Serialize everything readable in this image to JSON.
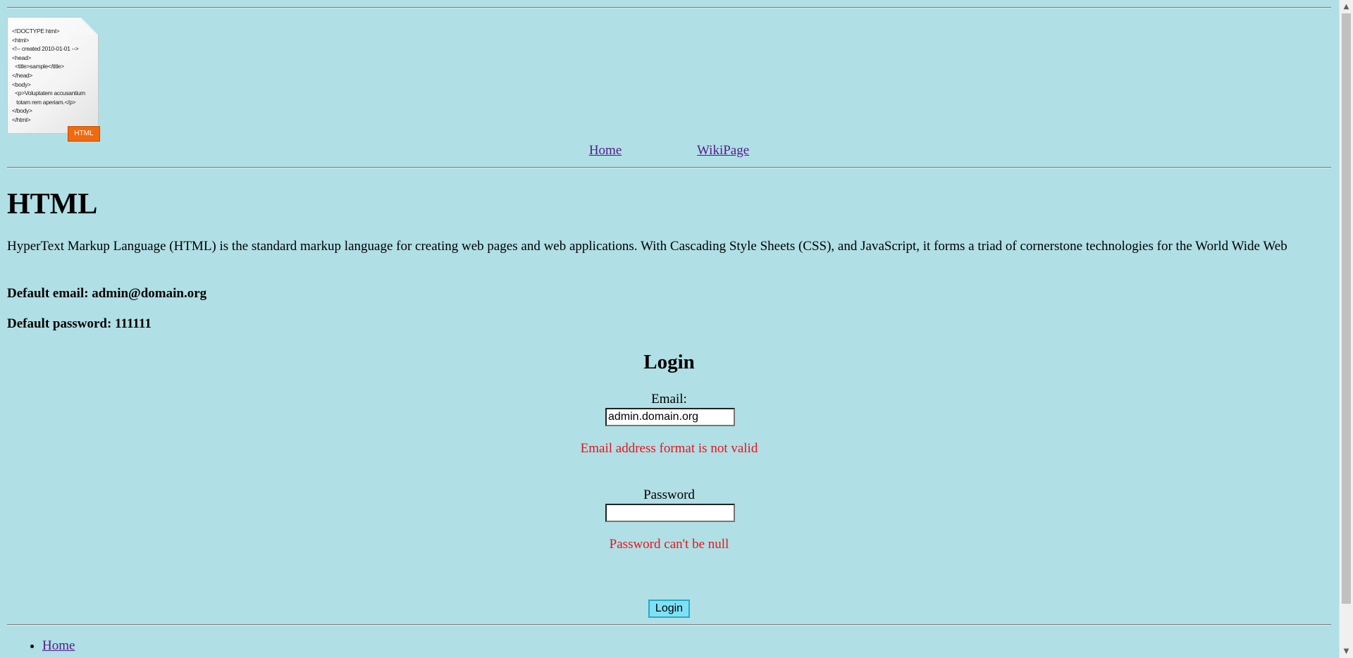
{
  "logo": {
    "code_lines": [
      "<!DOCTYPE html>",
      "<html>",
      "<!-- created 2010-01-01 -->",
      "<head>",
      "  <title>sample</title>",
      "</head>",
      "<body>",
      "  <p>Voluptatem accusantium",
      "   totam rem aperiam.</p>",
      "</body>",
      "</html>"
    ],
    "badge": "HTML"
  },
  "nav": {
    "home": "Home",
    "wiki": "WikiPage"
  },
  "main": {
    "title": "HTML",
    "intro": "HyperText Markup Language (HTML) is the standard markup language for creating web pages and web applications. With Cascading Style Sheets (CSS), and JavaScript, it forms a triad of cornerstone technologies for the World Wide Web",
    "default_email": "Default email: admin@domain.org",
    "default_password": "Default password: 111111"
  },
  "login": {
    "title": "Login",
    "email_label": "Email:",
    "email_value": "admin.domain.org",
    "email_error": "Email address format is not valid",
    "password_label": "Password",
    "password_value": "",
    "password_error": "Password can't be null",
    "button": "Login"
  },
  "footer": {
    "items": [
      "Home"
    ]
  },
  "colors": {
    "background": "#b0dfe5",
    "error": "#e8141c",
    "link_visited": "#551a8b",
    "button_bg": "#7fe0f5"
  },
  "icons": {
    "scroll_up": "chevron-up-icon",
    "scroll_down": "chevron-down-icon"
  }
}
